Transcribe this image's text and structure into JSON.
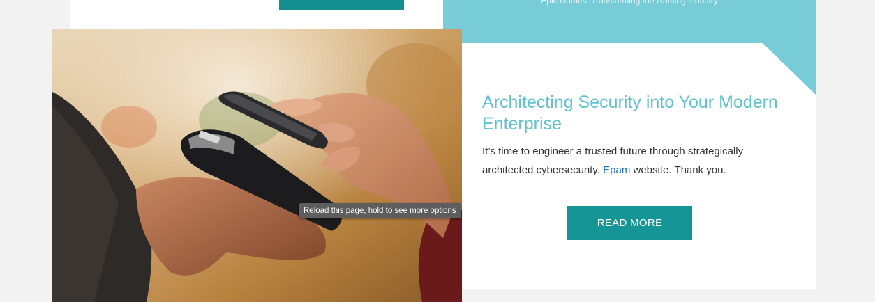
{
  "banner": {
    "text": "Epic Games: Transforming the Gaming Industry"
  },
  "article": {
    "title": "Architecting Security into Your Modern Enterprise",
    "description_before_link": "It’s time to engineer a trusted future through strategically architected cybersecurity. ",
    "link_text": "Epam",
    "description_after_link": " website. Thank you.",
    "read_more_label": "READ MORE",
    "image_icon": "contactless-payment-photo"
  },
  "tooltip": {
    "text": "Reload this page, hold to see more options"
  },
  "colors": {
    "teal_accent": "#78ccd8",
    "button_teal": "#159595",
    "title_teal": "#5ec2cf",
    "link_blue": "#1a6fce"
  }
}
